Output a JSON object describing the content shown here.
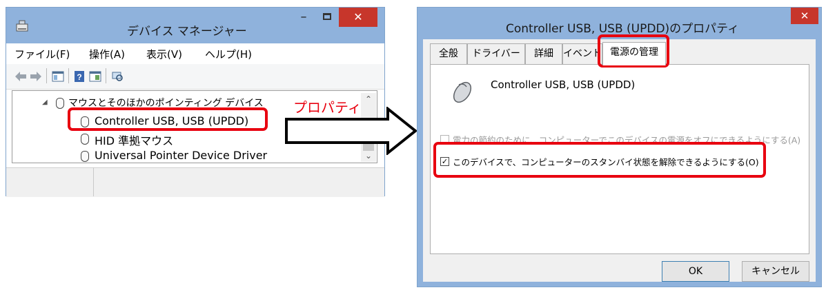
{
  "device_manager": {
    "title": "デバイス マネージャー",
    "menu": [
      "ファイル(F)",
      "操作(A)",
      "表示(V)",
      "ヘルプ(H)"
    ],
    "close_glyph": "✕",
    "min_glyph": "–",
    "tree": {
      "category": "マウスとそのほかのポインティング デバイス",
      "items": [
        "Controller USB, USB (UPDD)",
        "HID 準拠マウス",
        "Universal Pointer Device Driver"
      ]
    }
  },
  "annotation": {
    "label": "プロパティ"
  },
  "properties_dialog": {
    "title": "Controller USB, USB (UPDD)のプロパティ",
    "close_glyph": "✕",
    "tabs": [
      "全般",
      "ドライバー",
      "詳細",
      "イベント",
      "電源の管理"
    ],
    "active_tab": "電源の管理",
    "device_name": "Controller USB, USB (UPDD)",
    "options": [
      {
        "label": "電力の節約のために、コンピューターでこのデバイスの電源をオフにできるようにする(A)",
        "checked": false,
        "enabled": false
      },
      {
        "label": "このデバイスで、コンピューターのスタンバイ状態を解除できるようにする(O)",
        "checked": true,
        "enabled": true
      }
    ],
    "buttons": {
      "ok": "OK",
      "cancel": "キャンセル"
    }
  },
  "colors": {
    "titlebar": "#8fb2dc",
    "close": "#c7362b",
    "highlight": "#e8000f"
  }
}
